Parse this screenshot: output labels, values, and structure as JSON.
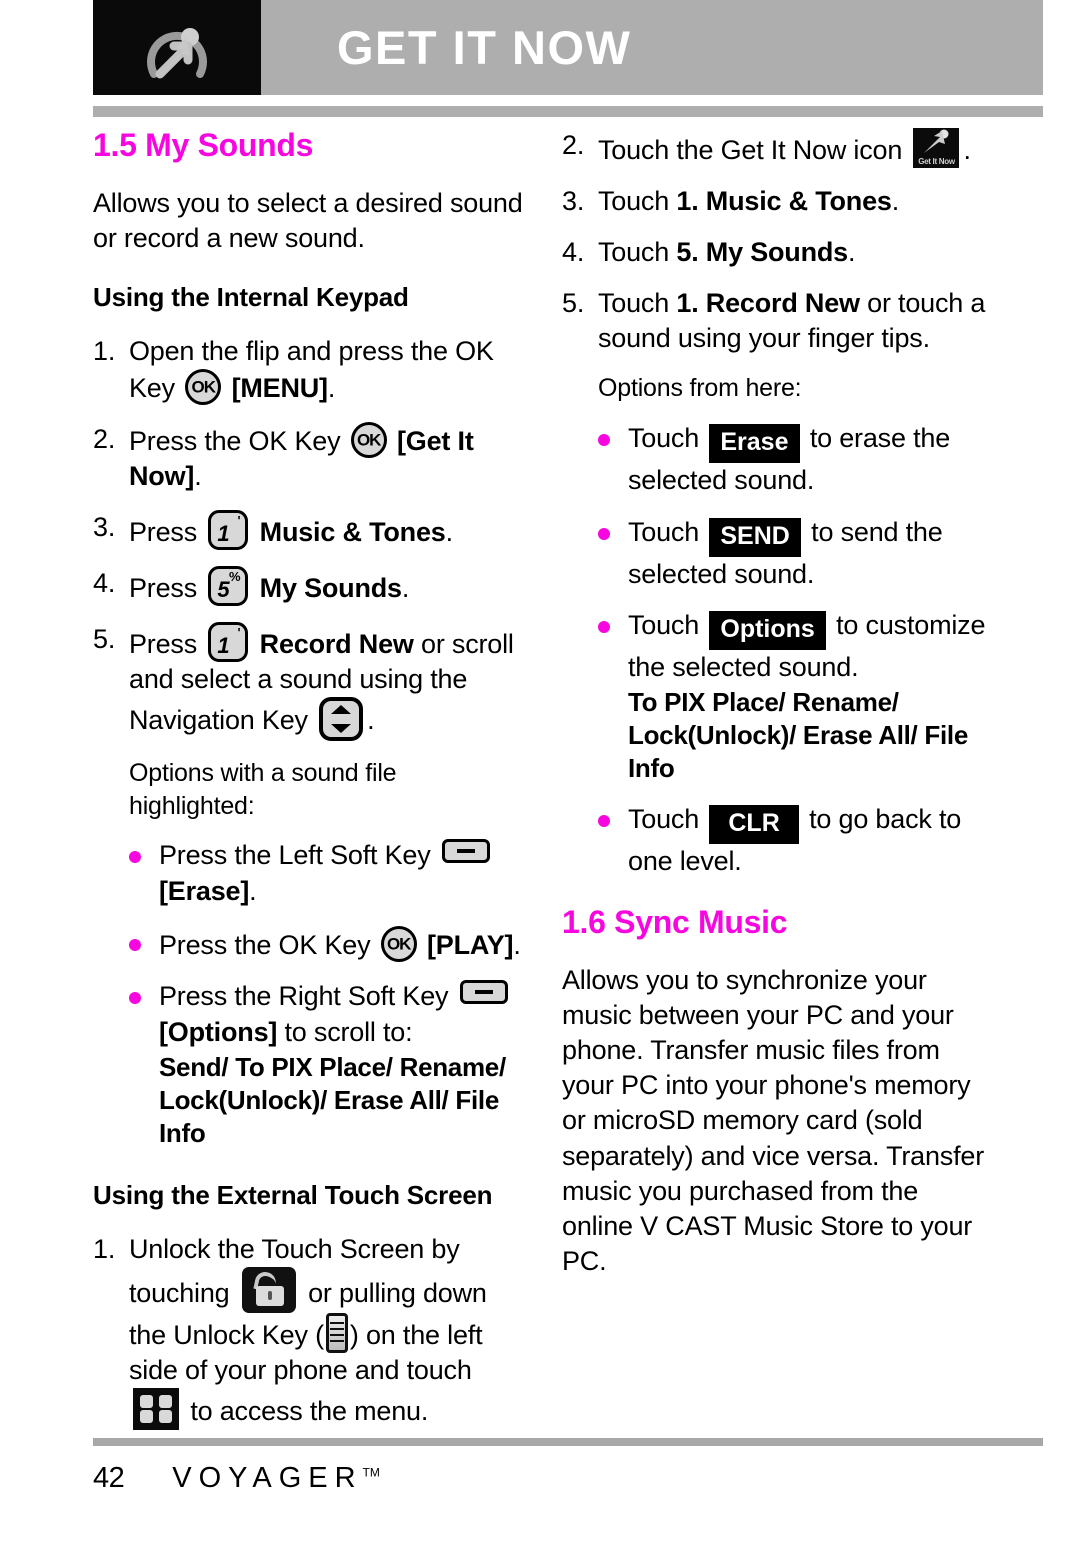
{
  "header": {
    "title": "GET IT NOW",
    "icon": "get-it-now-app-icon"
  },
  "left_column": {
    "section_title": "1.5 My Sounds",
    "intro": "Allows you to select a desired sound or record a new sound.",
    "subhead": "Using the Internal Keypad",
    "steps": [
      {
        "marker": "1.",
        "pre": "Open the flip and press the OK Key",
        "key": "ok-key",
        "key_label": "OK",
        "post_bold": "[MENU]",
        "post": "."
      },
      {
        "marker": "2.",
        "pre": "Press the OK Key",
        "key": "ok-key",
        "key_label": "OK",
        "post_bold": "[Get It Now]",
        "post": "."
      },
      {
        "marker": "3.",
        "pre": "Press",
        "key": "number-key-1",
        "key_digit": "1",
        "key_sup": "'",
        "post_bold": "Music & Tones",
        "post": "."
      },
      {
        "marker": "4.",
        "pre": "Press",
        "key": "number-key-5",
        "key_digit": "5",
        "key_sup": "%",
        "post_bold": "My Sounds",
        "post": "."
      },
      {
        "marker": "5.",
        "pre": "Press",
        "key": "number-key-1",
        "key_digit": "1",
        "key_sup": "'",
        "post_bold": "Record New",
        "post": " or scroll and select a sound using the Navigation Key",
        "trailing_key": "navigation-key",
        "tail": "."
      }
    ],
    "options_note": "Options with a sound file highlighted:",
    "bullets": [
      {
        "pre": "Press the Left Soft Key",
        "key": "soft-key",
        "post_bold": "[Erase]",
        "post": "."
      },
      {
        "pre": "Press the OK Key",
        "key": "ok-key",
        "key_label": "OK",
        "post_bold": "[PLAY]",
        "post": "."
      },
      {
        "pre": "Press the Right Soft Key",
        "key": "soft-key",
        "post_bold": "[Options]",
        "post": " to scroll to:",
        "options_list": "Send/ To PIX Place/ Rename/ Lock(Unlock)/ Erase All/ File Info"
      }
    ],
    "subhead2": "Using the External Touch Screen",
    "touch_step": {
      "marker": "1.",
      "part1": "Unlock the Touch Screen by touching",
      "icon1": "unlock-icon",
      "part2": "or pulling down the Unlock Key (",
      "icon2": "unlock-key-strip-icon",
      "part3": ") on the left side of your phone and touch",
      "icon3": "menu-grid-icon",
      "part4": "to access the menu."
    }
  },
  "right_column": {
    "steps": [
      {
        "marker": "2.",
        "pre": "Touch the Get It Now icon",
        "icon": "get-it-now-icon",
        "icon_label": "Get It Now",
        "post": "."
      },
      {
        "marker": "3.",
        "pre": "Touch",
        "post_bold": "1. Music & Tones",
        "post": "."
      },
      {
        "marker": "4.",
        "pre": "Touch",
        "post_bold": "5. My Sounds",
        "post": "."
      },
      {
        "marker": "5.",
        "pre": "Touch",
        "post_bold": "1. Record New",
        "post": " or touch a sound using your finger tips."
      }
    ],
    "options_note": "Options from here:",
    "bullets": [
      {
        "pre": "Touch",
        "btn": "Erase",
        "post": "to erase the selected sound."
      },
      {
        "pre": "Touch",
        "btn": "SEND",
        "post": "to send the selected sound."
      },
      {
        "pre": "Touch",
        "btn": "Options",
        "post": "to customize the selected sound.",
        "options_list": "To PIX Place/ Rename/ Lock(Unlock)/ Erase All/ File Info"
      },
      {
        "pre": "Touch",
        "btn": "CLR",
        "post": "to go back to one level."
      }
    ],
    "section_title": "1.6 Sync Music",
    "sync_body": "Allows you to synchronize your music between your PC and your phone. Transfer music files from your PC into your phone's memory or microSD memory card (sold separately) and vice versa. Transfer music you purchased from the online V CAST Music Store to your PC."
  },
  "footer": {
    "page_number": "42",
    "brand": "VOYAGER",
    "trademark": "TM"
  },
  "colors": {
    "accent_magenta": "#f706e0",
    "header_gray": "#aeaeae",
    "key_fill": "#d8d8d8"
  }
}
